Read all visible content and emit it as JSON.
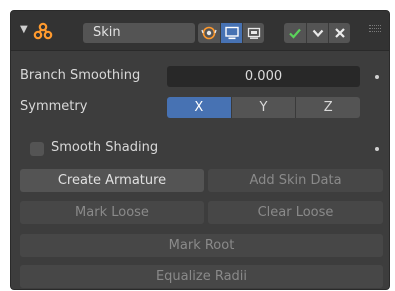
{
  "header": {
    "collapse_icon": "triangle-down-icon",
    "modifier_icon": "skin-modifier-icon",
    "name": "Skin",
    "toggles": [
      {
        "name": "edit-mode-cage-icon",
        "active": false
      },
      {
        "name": "edit-mode-icon",
        "active": true
      },
      {
        "name": "realtime-display-icon",
        "active": false
      }
    ],
    "actions": [
      {
        "name": "checkmark-icon"
      },
      {
        "name": "chevron-down-icon"
      },
      {
        "name": "close-icon"
      }
    ]
  },
  "branch_smoothing": {
    "label": "Branch Smoothing",
    "value": "0.000"
  },
  "symmetry": {
    "label": "Symmetry",
    "options": [
      "X",
      "Y",
      "Z"
    ],
    "active": "X"
  },
  "smooth_shading": {
    "label": "Smooth Shading",
    "checked": false
  },
  "buttons": {
    "create_armature": "Create Armature",
    "add_skin_data": "Add Skin Data",
    "mark_loose": "Mark Loose",
    "clear_loose": "Clear Loose",
    "mark_root": "Mark Root",
    "equalize_radii": "Equalize Radii"
  },
  "colors": {
    "panel_bg": "#3d3d3d",
    "accent_blue": "#4772b3",
    "check_green": "#5bd35b",
    "modifier_orange": "#ff9a2e"
  }
}
